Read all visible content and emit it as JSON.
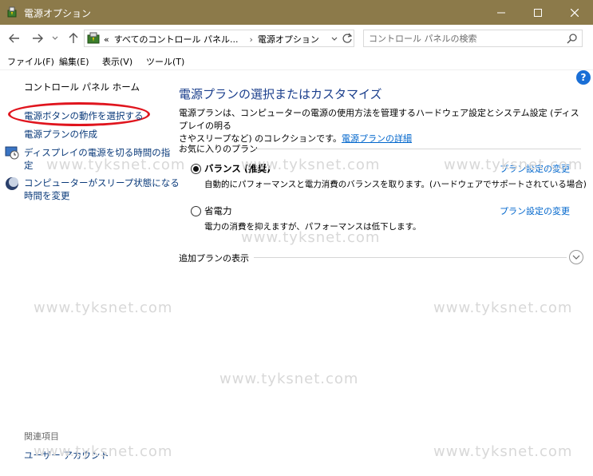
{
  "window": {
    "title": "電源オプション"
  },
  "address": {
    "overflow": "«",
    "crumbs": [
      "すべてのコントロール パネル...",
      "電源オプション"
    ],
    "separator": "›"
  },
  "search": {
    "placeholder": "コントロール パネルの検索"
  },
  "menu": [
    "ファイル(F)",
    "編集(E)",
    "表示(V)",
    "ツール(T)"
  ],
  "left_pane": {
    "home": "コントロール パネル ホーム",
    "items": [
      "電源ボタンの動作を選択する",
      "電源プランの作成",
      "ディスプレイの電源を切る時間の指定",
      "コンピューターがスリープ状態になる時間を変更"
    ],
    "display_item_line1": "ディスプレイの電源を切る時間の指",
    "display_item_line2": "定",
    "sleep_item_line1": "コンピューターがスリープ状態になる",
    "sleep_item_line2": "時間を変更",
    "related_title": "関連項目",
    "related_items": [
      "ユーザー アカウント"
    ]
  },
  "main": {
    "heading": "電源プランの選択またはカスタマイズ",
    "description_line1": "電源プランは、コンピューターの電源の使用方法を管理するハードウェア設定とシステム設定 (ディスプレイの明る",
    "description_line2": "さやスリープなど) のコレクションです。",
    "details_link": "電源プランの詳細",
    "favorites_label": "お気に入りのプラン",
    "plans": [
      {
        "name": "バランス (推奨)",
        "desc": "自動的にパフォーマンスと電力消費のバランスを取ります。(ハードウェアでサポートされている場合)",
        "link": "プラン設定の変更",
        "selected": true
      },
      {
        "name": "省電力",
        "desc": "電力の消費を抑えますが、パフォーマンスは低下します。",
        "link": "プラン設定の変更",
        "selected": false
      }
    ],
    "more_plans": "追加プランの表示"
  },
  "watermark": "www.tyksnet.com",
  "colors": {
    "titlebar": "#8c7a4a",
    "heading": "#1a3e8c",
    "link": "#0066cc",
    "highlight": "#e0151e"
  }
}
